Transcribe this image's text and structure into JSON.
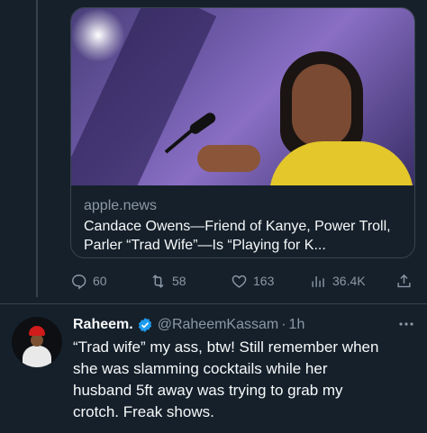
{
  "card": {
    "domain": "apple.news",
    "title": "Candace Owens—Friend of Kanye, Power Troll, Parler “Trad Wife”—Is “Playing for K..."
  },
  "actions": {
    "replies": "60",
    "retweets": "58",
    "likes": "163",
    "views": "36.4K"
  },
  "reply": {
    "name": "Raheem.",
    "handle": "@RaheemKassam",
    "separator": "·",
    "time": "1h",
    "text": "“Trad wife” my ass, btw! Still remember when\nshe was slamming cocktails while her\nhusband 5ft away was trying to grab my\ncrotch. Freak shows."
  },
  "colors": {
    "background": "#15202b",
    "secondary_text": "#8b98a5",
    "verified_blue": "#1d9bf0",
    "border": "#38444d"
  },
  "icons": [
    "reply-icon",
    "retweet-icon",
    "like-icon",
    "views-icon",
    "share-icon",
    "verified-badge-icon",
    "more-icon"
  ]
}
